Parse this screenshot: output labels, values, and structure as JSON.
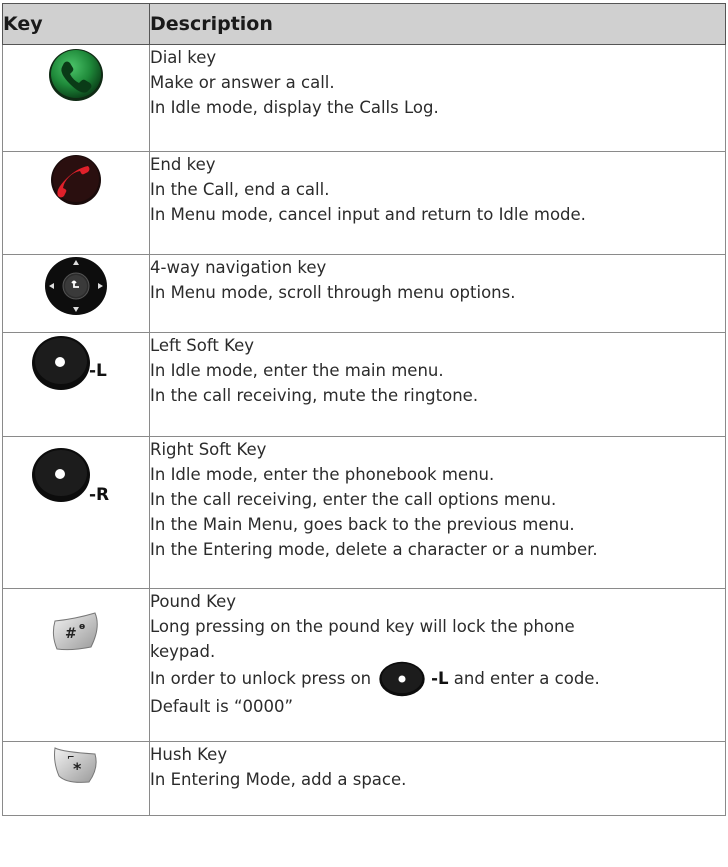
{
  "table": {
    "headers": {
      "key": "Key",
      "description": "Description"
    },
    "rows": [
      {
        "icon": "dial-key-icon",
        "lines": [
          "Dial key",
          "Make or answer a call.",
          "In Idle mode, display the Calls Log."
        ]
      },
      {
        "icon": "end-key-icon",
        "lines": [
          "End key",
          "In the Call, end a call.",
          "In Menu mode, cancel input and return to Idle mode."
        ]
      },
      {
        "icon": "navigation-key-icon",
        "lines": [
          "4-way navigation key",
          "In Menu mode, scroll through menu options."
        ]
      },
      {
        "icon": "left-soft-key-icon",
        "suffix": "-L",
        "lines": [
          "Left Soft Key",
          "In Idle mode, enter the main menu.",
          "In the call receiving, mute the ringtone."
        ]
      },
      {
        "icon": "right-soft-key-icon",
        "suffix": "-R",
        "lines": [
          "Right Soft Key",
          "In Idle mode, enter the phonebook menu.",
          "In the call receiving, enter the call options menu.",
          "In the Main Menu, goes back to the previous menu.",
          "In the Entering mode, delete a character or a number."
        ]
      },
      {
        "icon": "pound-key-icon",
        "lines": [
          "Pound Key",
          "Long pressing on the pound key will lock the phone",
          "keypad."
        ],
        "unlock_prefix": "In order to unlock press on",
        "unlock_key": "-L",
        "unlock_suffix": "and enter a code.",
        "default_line": "Default is “0000”"
      },
      {
        "icon": "hush-key-icon",
        "lines": [
          "Hush Key",
          "In Entering Mode, add a space."
        ]
      }
    ]
  },
  "colors": {
    "header_bg": "#d0d0d0",
    "border": "#8a8a8a",
    "dial_green": "#1f8a3a",
    "end_red": "#d21f2a",
    "key_black": "#111111"
  }
}
